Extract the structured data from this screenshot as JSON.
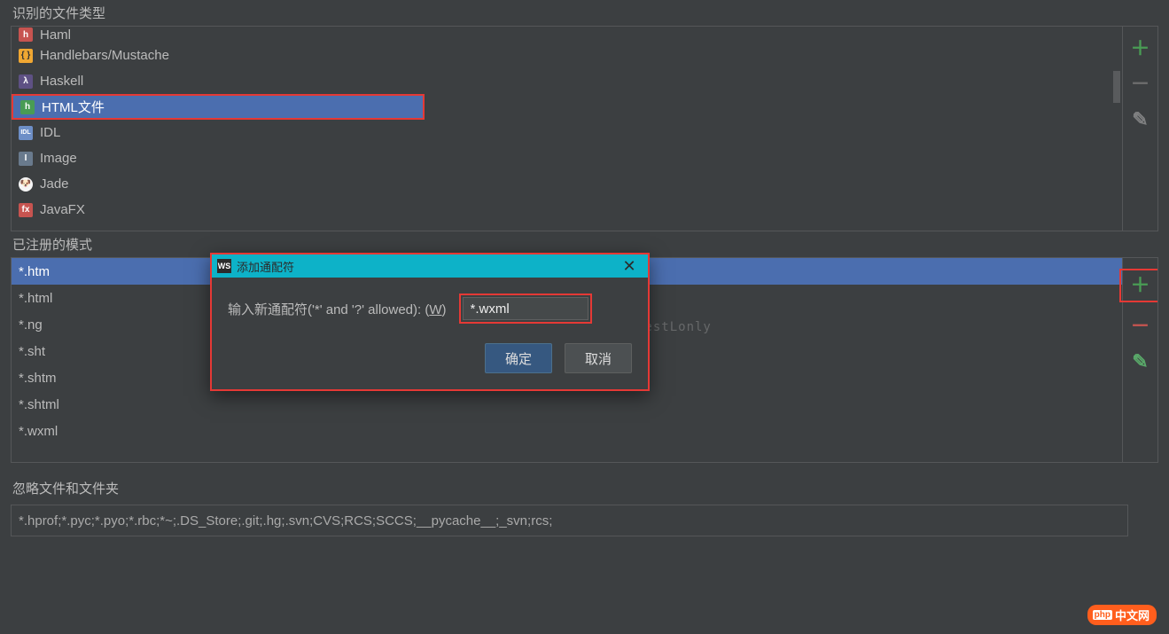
{
  "labels": {
    "recognized_types": "识别的文件类型",
    "registered_patterns": "已注册的模式",
    "ignore_files": "忽略文件和文件夹"
  },
  "file_types": {
    "haml": "Haml",
    "handlebars": "Handlebars/Mustache",
    "haskell": "Haskell",
    "html_file": "HTML文件",
    "idl": "IDL",
    "image": "Image",
    "jade": "Jade",
    "javafx": "JavaFX"
  },
  "patterns": {
    "htm": "*.htm",
    "html": "*.html",
    "ng": "*.ng",
    "sht": "*.sht",
    "shtm": "*.shtm",
    "shtml": "*.shtml",
    "wxml": "*.wxml"
  },
  "ignore_value": "*.hprof;*.pyc;*.pyo;*.rbc;*~;.DS_Store;.git;.hg;.svn;CVS;RCS;SCCS;__pycache__;_svn;rcs;",
  "dialog": {
    "title": "添加通配符",
    "prompt_prefix": "输入新通配符('*' and '?' allowed): (",
    "prompt_key": "W",
    "prompt_suffix": ")",
    "input_value": "*.wxml",
    "ok": "确定",
    "cancel": "取消"
  },
  "watermark": "http://blog.csdn.net/WestLonly",
  "footer": {
    "brand_prefix": "php",
    "brand_suffix": "中文网"
  },
  "glyphs": {
    "plus": "＋",
    "minus": "－",
    "pencil": "✎",
    "close": "✕"
  },
  "icons": {
    "haml": "h",
    "hb": "{ }",
    "hs": "λ",
    "html": "h",
    "idl": "IDL",
    "img": "I",
    "jade": "🐶",
    "jfx": "fx"
  }
}
